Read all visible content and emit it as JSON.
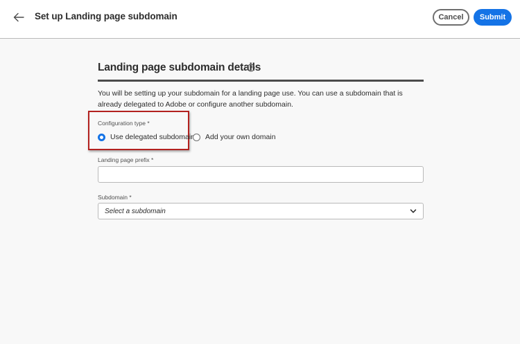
{
  "header": {
    "title": "Set up Landing page subdomain",
    "cancel_label": "Cancel",
    "submit_label": "Submit",
    "back_icon": "arrow-left-icon"
  },
  "colors": {
    "accent": "#1473e6",
    "highlight": "#b3211f",
    "background": "#f8f8f8"
  },
  "section": {
    "title": "Landing page subdomain details",
    "help_icon": "help-circle-icon",
    "description": "You will be setting up your subdomain for a landing page use. You can use a subdomain that is already delegated to Adobe or configure another subdomain."
  },
  "config_type": {
    "label": "Configuration type",
    "required_mark": "*",
    "options": [
      {
        "label": "Use delegated subdomain",
        "selected": true
      },
      {
        "label": "Add your own domain",
        "selected": false
      }
    ]
  },
  "prefix": {
    "label": "Landing page prefix",
    "required_mark": "*",
    "value": "",
    "placeholder": ""
  },
  "subdomain": {
    "label": "Subdomain",
    "required_mark": "*",
    "placeholder": "Select a subdomain",
    "chevron_icon": "chevron-down-icon"
  }
}
